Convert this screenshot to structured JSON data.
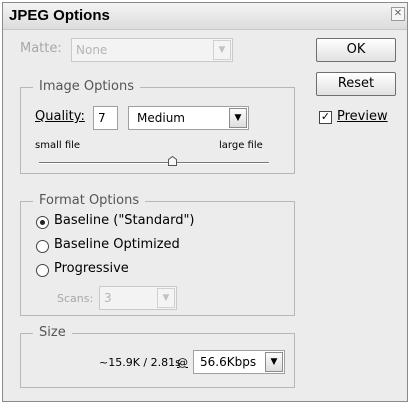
{
  "dialog": {
    "title": "JPEG Options",
    "close_glyph": "✕"
  },
  "matte": {
    "label": "Matte:",
    "value": "None",
    "enabled": false
  },
  "image_options": {
    "legend": "Image Options",
    "quality_label": "Quality:",
    "quality_value": "7",
    "quality_preset": "Medium",
    "slider_min_label": "small file",
    "slider_max_label": "large file",
    "slider_value_fraction": 0.58
  },
  "format_options": {
    "legend": "Format Options",
    "options": [
      {
        "label": "Baseline (\"Standard\")",
        "selected": true
      },
      {
        "label": "Baseline Optimized",
        "selected": false
      },
      {
        "label": "Progressive",
        "selected": false
      }
    ],
    "scans_label": "Scans:",
    "scans_value": "3",
    "scans_enabled": false
  },
  "size": {
    "legend": "Size",
    "estimate": "~15.9K / 2.81s",
    "at_symbol": "@",
    "speed": "56.6Kbps"
  },
  "buttons": {
    "ok": "OK",
    "reset": "Reset"
  },
  "preview": {
    "label": "Preview",
    "checked": true,
    "check_glyph": "✓"
  },
  "icons": {
    "dropdown": "▼"
  }
}
